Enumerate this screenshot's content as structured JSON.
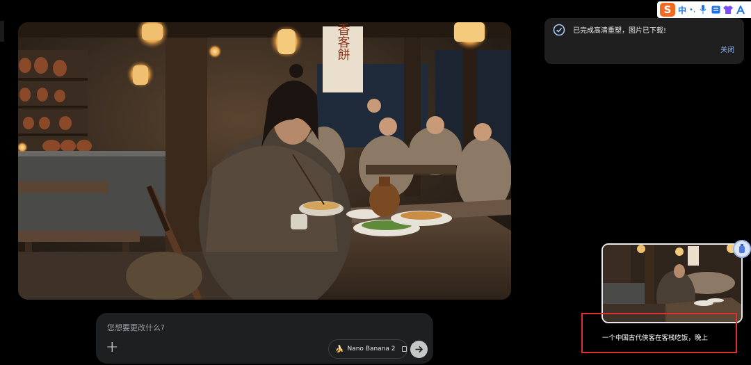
{
  "notification": {
    "message": "已完成高清重塑，图片已下载!",
    "close_label": "关闭"
  },
  "tray": {
    "ime_logo": "S",
    "ime_mode": "中",
    "punct": "•,",
    "icons": [
      "sogou-logo-icon",
      "microphone-icon",
      "keyboard-icon",
      "shirt-icon",
      "translate-icon"
    ]
  },
  "image": {
    "sign_text": "香客餅"
  },
  "prompt": {
    "placeholder": "您想要更改什么?",
    "value": "",
    "model_label": "Nano Banana 2"
  },
  "thumbnail": {
    "caption": "一个中国古代侠客在客栈吃饭，晚上"
  },
  "colors": {
    "background": "#000000",
    "toast_bg": "#1f1f1f",
    "accent_link": "#8ab4f8",
    "highlight_border": "#e03131",
    "prompt_bg": "#1e1f20"
  }
}
